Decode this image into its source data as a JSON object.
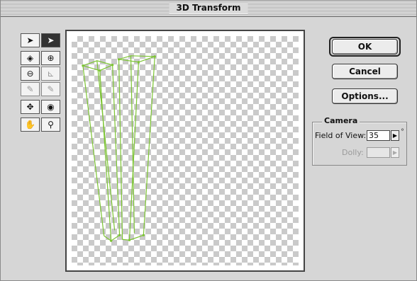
{
  "window": {
    "title": "3D Transform"
  },
  "tools": [
    [
      {
        "name": "selection-tool-icon",
        "glyph": "➤",
        "dark": false
      },
      {
        "name": "direct-selection-tool-icon",
        "glyph": "➤",
        "dark": true
      }
    ],
    [
      {
        "name": "cube-tool-icon",
        "glyph": "◈",
        "dark": false
      },
      {
        "name": "sphere-tool-icon",
        "glyph": "⊕",
        "dark": false
      }
    ],
    [
      {
        "name": "cylinder-tool-icon",
        "glyph": "⊖",
        "dark": false
      },
      {
        "name": "convert-anchor-tool-icon",
        "glyph": "⊾",
        "dark": false,
        "disabled": true
      }
    ],
    [
      {
        "name": "add-anchor-tool-icon",
        "glyph": "✎",
        "dark": false,
        "disabled": true
      },
      {
        "name": "delete-anchor-tool-icon",
        "glyph": "✎",
        "dark": false,
        "disabled": true
      }
    ],
    [
      {
        "name": "pan-camera-tool-icon",
        "glyph": "✥",
        "dark": false
      },
      {
        "name": "trackball-tool-icon",
        "glyph": "◉",
        "dark": false
      }
    ],
    [
      {
        "name": "hand-tool-icon",
        "glyph": "✋",
        "dark": false
      },
      {
        "name": "zoom-tool-icon",
        "glyph": "⚲",
        "dark": false
      }
    ]
  ],
  "buttons": {
    "ok": "OK",
    "cancel": "Cancel",
    "options": "Options..."
  },
  "camera": {
    "group_label": "Camera",
    "field_of_view_label": "Field of View:",
    "field_of_view_value": "35",
    "field_of_view_unit": "°",
    "dolly_label": "Dolly:",
    "dolly_value": ""
  },
  "colors": {
    "wireframe": "#7bc431"
  }
}
